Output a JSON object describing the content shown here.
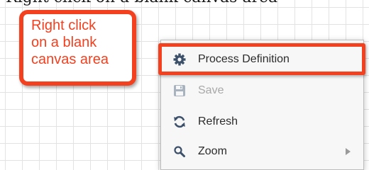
{
  "partial_top_text": "Right click on a blank canvas area",
  "callout": {
    "lines": [
      "Right click",
      "on a blank",
      "canvas area"
    ]
  },
  "context_menu": {
    "items": [
      {
        "label": "Process Definition",
        "icon": "gear-icon",
        "enabled": true,
        "highlighted": true
      },
      {
        "label": "Save",
        "icon": "save-icon",
        "enabled": false
      },
      {
        "label": "Refresh",
        "icon": "refresh-icon",
        "enabled": true
      },
      {
        "label": "Zoom",
        "icon": "search-icon",
        "enabled": true,
        "has_submenu": true
      }
    ]
  },
  "colors": {
    "accent": "#f3401f",
    "menu_background": "#f7f7f7",
    "grid": "#e3e3e3"
  }
}
